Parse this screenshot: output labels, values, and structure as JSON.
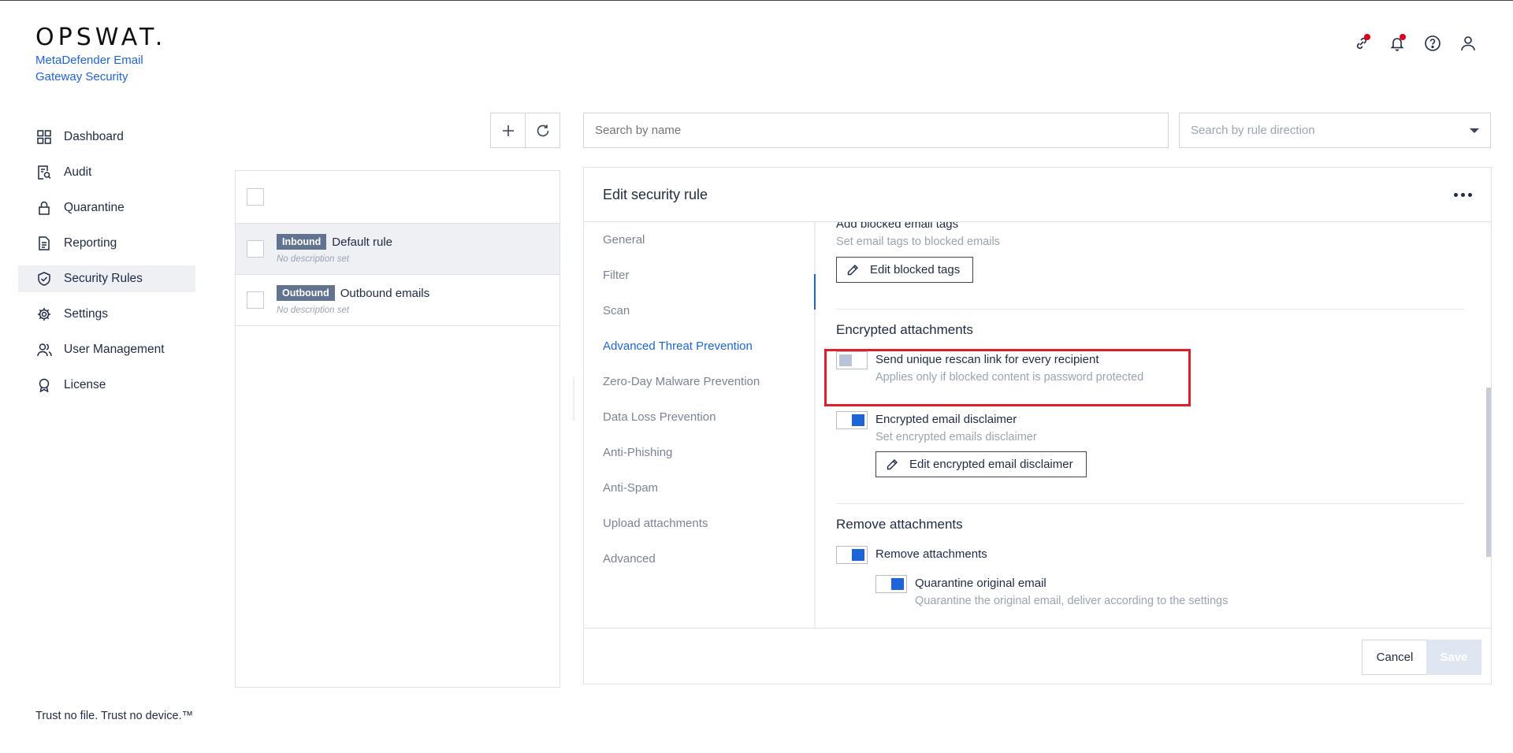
{
  "brand": {
    "logo": "OPSWAT.",
    "product_line1": "MetaDefender Email",
    "product_line2": "Gateway Security"
  },
  "header_icons": [
    "link-alert-icon",
    "bell-icon",
    "help-icon",
    "user-icon"
  ],
  "accent_color": "#1d64d8",
  "highlight_color": "#e01e2b",
  "sidebar": {
    "items": [
      {
        "label": "Dashboard",
        "icon": "dashboard-icon"
      },
      {
        "label": "Audit",
        "icon": "audit-icon"
      },
      {
        "label": "Quarantine",
        "icon": "lock-icon"
      },
      {
        "label": "Reporting",
        "icon": "report-icon"
      },
      {
        "label": "Security Rules",
        "icon": "shield-check-icon",
        "active": true
      },
      {
        "label": "Settings",
        "icon": "gear-icon"
      },
      {
        "label": "User Management",
        "icon": "users-icon"
      },
      {
        "label": "License",
        "icon": "award-icon"
      }
    ]
  },
  "footer": {
    "tagline": "Trust no file. Trust no device.™"
  },
  "search": {
    "name_placeholder": "Search by name",
    "direction_placeholder": "Search by rule direction"
  },
  "rules": [
    {
      "direction": "Inbound",
      "name": "Default rule",
      "description": "No description set",
      "selected": true
    },
    {
      "direction": "Outbound",
      "name": "Outbound emails",
      "description": "No description set",
      "selected": false
    }
  ],
  "editor": {
    "title": "Edit security rule",
    "tabs": [
      "General",
      "Filter",
      "Scan",
      "Advanced Threat Prevention",
      "Zero-Day Malware Prevention",
      "Data Loss Prevention",
      "Anti-Phishing",
      "Anti-Spam",
      "Upload attachments",
      "Advanced"
    ],
    "active_tab": "Advanced Threat Prevention",
    "blocked_tags": {
      "title": "Add blocked email tags",
      "subtitle": "Set email tags to blocked emails",
      "button": "Edit blocked tags"
    },
    "encrypted": {
      "section_title": "Encrypted attachments",
      "rescan_label": "Send unique rescan link for every recipient",
      "rescan_sub": "Applies only if blocked content is password protected",
      "rescan_enabled": false,
      "disclaimer_label": "Encrypted email disclaimer",
      "disclaimer_sub": "Set encrypted emails disclaimer",
      "disclaimer_enabled": true,
      "disclaimer_button": "Edit encrypted email disclaimer"
    },
    "remove": {
      "section_title": "Remove attachments",
      "remove_label": "Remove attachments",
      "remove_enabled": true,
      "quarantine_label": "Quarantine original email",
      "quarantine_sub": "Quarantine the original email, deliver according to the settings",
      "quarantine_enabled": true
    },
    "cancel_label": "Cancel",
    "save_label": "Save"
  }
}
